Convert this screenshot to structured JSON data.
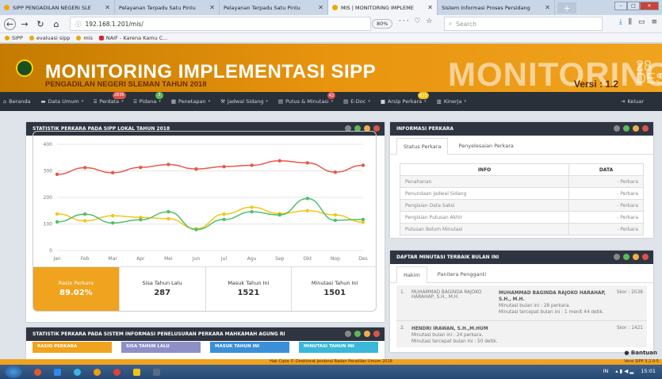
{
  "browser": {
    "tabs": [
      {
        "title": "SIPP PENGADILAN NEGERI SLE",
        "close": "✕",
        "icon_color": "#e9a700"
      },
      {
        "title": "Pelayanan Terpadu Satu Pintu",
        "close": "✕",
        "icon_color": ""
      },
      {
        "title": "Pelayanan Terpadu Satu Pintu",
        "close": "✕",
        "icon_color": ""
      },
      {
        "title": "MIS | MONITORING IMPLEME",
        "close": "✕",
        "icon_color": "#e9a700"
      },
      {
        "title": "Sistem Informasi Proses Persidang",
        "close": "✕",
        "icon_color": ""
      }
    ],
    "new_tab": "+",
    "url": "192.168.1.201/mis/",
    "zoom": "80%",
    "page_actions": "··· ♡ ☆",
    "search_placeholder": "Search",
    "bookmarks": [
      {
        "label": "SIPP"
      },
      {
        "label": "evaluasi sipp"
      },
      {
        "label": "mis"
      },
      {
        "label": "NAIF - Karena Kamu C..."
      }
    ]
  },
  "banner": {
    "title": "MONITORING IMPLEMENTASI SIPP",
    "subtitle": "PENGADILAN NEGERI SLEMAN TAHUN 2018",
    "big_word": "MONITORING",
    "version": "Versi : 1.2",
    "date_day": "28",
    "date_month": "DES"
  },
  "menu": {
    "items": [
      {
        "label": "Beranda",
        "caret": ""
      },
      {
        "label": "Data Umum",
        "caret": "▾"
      },
      {
        "label": "Perdata",
        "caret": "▾",
        "badge": "2836",
        "badge_color": "#d9534f"
      },
      {
        "label": "Pidana",
        "caret": "▾",
        "badge": "3",
        "badge_color": "#5cb85c"
      },
      {
        "label": "Penetapan",
        "caret": "▾"
      },
      {
        "label": "Jadwal Sidang",
        "caret": "▾"
      },
      {
        "label": "Putus & Minutasi",
        "caret": "▾",
        "badge": "42",
        "badge_color": "#d9534f"
      },
      {
        "label": "E-Doc",
        "caret": "▾"
      },
      {
        "label": "Arsip Perkara",
        "caret": "▾",
        "badge": "622",
        "badge_color": "#f0c419"
      },
      {
        "label": "Kinerja",
        "caret": "▾"
      }
    ],
    "logout": "Keluar"
  },
  "stat_panel": {
    "title": "STATISTIK PERKARA PADA SIPP LOKAL TAHUN 2018",
    "stats": [
      {
        "label": "Rasio Perkara",
        "value": "89.02%"
      },
      {
        "label": "Sisa Tahun Lalu",
        "value": "287"
      },
      {
        "label": "Masuk Tahun Ini",
        "value": "1521"
      },
      {
        "label": "Minutasi Tahun Ini",
        "value": "1501"
      }
    ]
  },
  "chart_data": {
    "type": "line",
    "categories": [
      "Jan",
      "Feb",
      "Mar",
      "Apr",
      "Mei",
      "Jun",
      "Jul",
      "Agu",
      "Sep",
      "Okt",
      "Nop",
      "Des"
    ],
    "ylim": [
      0,
      400
    ],
    "yticks": [
      0,
      100,
      200,
      300,
      400
    ],
    "grid": true,
    "series": [
      {
        "color": "#e8574a",
        "values": [
          287,
          312,
          293,
          313,
          324,
          307,
          316,
          321,
          338,
          330,
          295,
          321
        ]
      },
      {
        "color": "#f5c518",
        "values": [
          138,
          112,
          131,
          125,
          120,
          82,
          137,
          163,
          139,
          150,
          134,
          107
        ]
      },
      {
        "color": "#4fc06a",
        "values": [
          108,
          137,
          104,
          116,
          146,
          79,
          117,
          146,
          134,
          196,
          114,
          117
        ]
      }
    ]
  },
  "info_panel": {
    "title": "INFORMASI PERKARA",
    "tabs": [
      "Status Perkara",
      "Penyelesaian Perkara"
    ],
    "columns": [
      "INFO",
      "DATA"
    ],
    "rows": [
      {
        "info": "Penahanan",
        "data": "- Perkara"
      },
      {
        "info": "Penundaan Jadwal Sidang",
        "data": "- Perkara"
      },
      {
        "info": "Pengisian Data Saksi",
        "data": "- Perkara"
      },
      {
        "info": "Pengisian Putusan Akhir",
        "data": "- Perkara"
      },
      {
        "info": "Putusan Belum Minutasi",
        "data": "- Perkara"
      }
    ]
  },
  "minutasi_panel": {
    "title": "DAFTAR MINUTASI TERBAIK BULAN INI",
    "tabs": [
      "Hakim",
      "Panitera Pengganti"
    ],
    "rows": [
      {
        "no": "1.",
        "name": "MUHAMMAD BAGINDA RAJOKO HARAHAP, S.H., M.H.",
        "detail_name": "MUHAMMAD BAGINDA RAJOKO HARAHAP, S.H., M.H.",
        "line1": "Minutasi bulan ini : 28 perkara.",
        "line2": "Minutasi tercepat bulan ini : 1 menit 44 detik.",
        "score": "Skor : 2038"
      },
      {
        "no": "2.",
        "name": "",
        "detail_name": "HENDRI IRAWAN, S.H.,M.HUM",
        "line1": "Minutasi bulan ini : 24 perkara.",
        "line2": "Minutasi tercepat bulan ini : 50 detik.",
        "score": "Skor : 1421"
      }
    ]
  },
  "ma_panel": {
    "title": "STATISTIK PERKARA PADA SISTEM INFORMASI PENELUSURAN PERKARA MAHKAMAH AGUNG RI",
    "boxes": [
      {
        "label": "RASIO PERKARA",
        "color": "#f0a31f"
      },
      {
        "label": "SISA TAHUN LALU",
        "color": "#8e8fc7"
      },
      {
        "label": "MASUK TAHUN INI",
        "color": "#3b8fd9"
      },
      {
        "label": "MINUTASI TAHUN INI",
        "color": "#3bb7d9"
      }
    ]
  },
  "footer": {
    "text": "Hak Cipta © Direktorat Jenderal Badan Peradilan Umum 2018",
    "version": "Versi SIPP 3.2.0-5",
    "help": "Bantuan"
  },
  "taskbar": {
    "lang": "IN",
    "time": "15:01"
  }
}
